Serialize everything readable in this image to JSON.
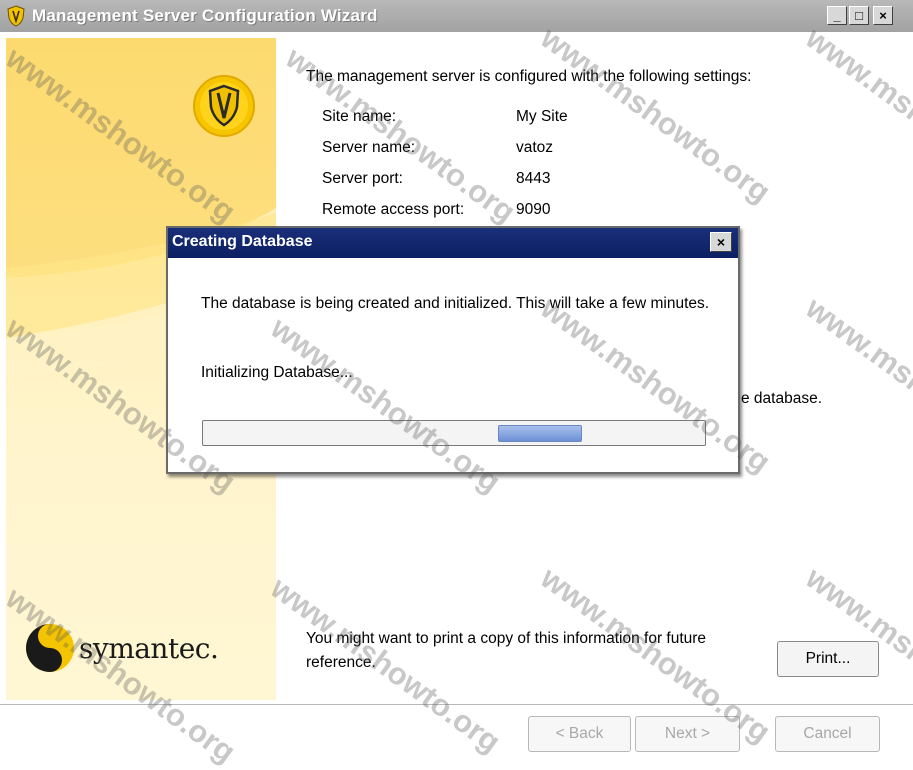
{
  "window": {
    "title": "Management Server Configuration Wizard",
    "controls": {
      "minimize": "_",
      "maximize": "□",
      "close": "×"
    }
  },
  "sidebar": {
    "brand": "symantec."
  },
  "main": {
    "intro": "The management server is configured with the following settings:",
    "settings": [
      {
        "label": "Site name:",
        "value": "My Site"
      },
      {
        "label": "Server name:",
        "value": "vatoz"
      },
      {
        "label": "Server port:",
        "value": "8443"
      },
      {
        "label": "Remote access port:",
        "value": "9090"
      }
    ],
    "partial_text": "e database.",
    "print_note": "You might want to print a copy of this information for future reference.",
    "print_button": "Print..."
  },
  "footer": {
    "back": "< Back",
    "next": "Next >",
    "cancel": "Cancel"
  },
  "dialog": {
    "title": "Creating Database",
    "close": "×",
    "message": "The database is being created and initialized. This will take a few minutes.",
    "status": "Initializing Database..."
  },
  "watermark": "www.mshowto.org",
  "icons": {
    "app": "shield-icon",
    "brand": "symantec-logo-icon"
  },
  "colors": {
    "dialog_title": "#0c1f62",
    "left_panel": "#fde79a",
    "brand_yellow": "#f5c400"
  }
}
